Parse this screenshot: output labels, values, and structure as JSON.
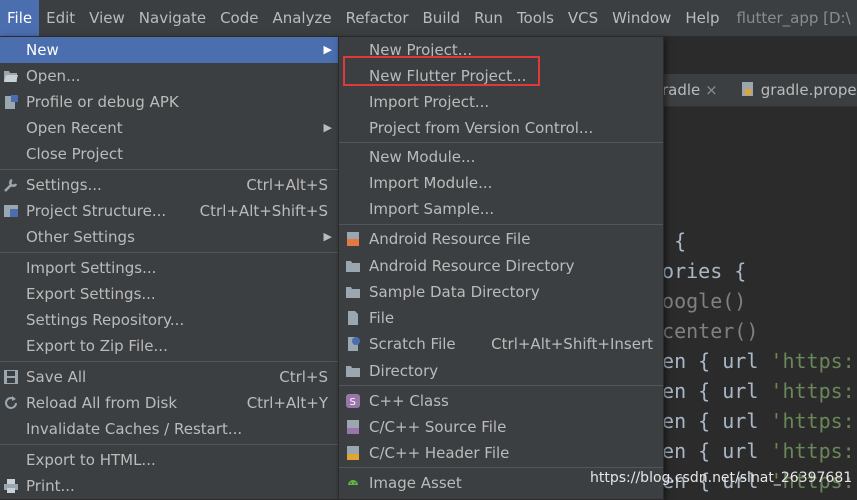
{
  "menubar": {
    "items": [
      "File",
      "Edit",
      "View",
      "Navigate",
      "Code",
      "Analyze",
      "Refactor",
      "Build",
      "Run",
      "Tools",
      "VCS",
      "Window",
      "Help"
    ],
    "title": "flutter_app [D:\\"
  },
  "editor": {
    "tab1": "radle",
    "tab1_close": "×",
    "tab2": "gradle.prope",
    "code": [
      {
        "a": "s {",
        "b": ""
      },
      {
        "a": "tories {",
        "b": ""
      },
      {
        "a": "google()",
        "b": ""
      },
      {
        "a": "jcenter()",
        "b": ""
      },
      {
        "a": "ven { url ",
        "b": "'https:"
      },
      {
        "a": "ven { url ",
        "b": "'https:"
      },
      {
        "a": "ven { url ",
        "b": "'https:"
      },
      {
        "a": "ven { url ",
        "b": "'https:"
      },
      {
        "a": "ven { url ",
        "b": "'https:"
      }
    ]
  },
  "file_menu": {
    "new": "New",
    "open": "Open...",
    "profile_apk": "Profile or debug APK",
    "open_recent": "Open Recent",
    "close_project": "Close Project",
    "settings": "Settings...",
    "settings_sc": "Ctrl+Alt+S",
    "project_structure": "Project Structure...",
    "project_structure_sc": "Ctrl+Alt+Shift+S",
    "other_settings": "Other Settings",
    "import_settings": "Import Settings...",
    "export_settings": "Export Settings...",
    "settings_repository": "Settings Repository...",
    "export_zip": "Export to Zip File...",
    "save_all": "Save All",
    "save_all_sc": "Ctrl+S",
    "reload": "Reload All from Disk",
    "reload_sc": "Ctrl+Alt+Y",
    "invalidate": "Invalidate Caches / Restart...",
    "export_html": "Export to HTML...",
    "print": "Print..."
  },
  "new_menu": {
    "new_project": "New Project...",
    "new_flutter_project": "New Flutter Project...",
    "import_project": "Import Project...",
    "project_vcs": "Project from Version Control...",
    "new_module": "New Module...",
    "import_module": "Import Module...",
    "import_sample": "Import Sample...",
    "android_resource_file": "Android Resource File",
    "android_resource_directory": "Android Resource Directory",
    "sample_data_directory": "Sample Data Directory",
    "file": "File",
    "scratch_file": "Scratch File",
    "scratch_file_sc": "Ctrl+Alt+Shift+Insert",
    "directory": "Directory",
    "cpp_class": "C++ Class",
    "cpp_source": "C/C++ Source File",
    "cpp_header": "C/C++ Header File",
    "image_asset": "Image Asset"
  },
  "watermark": "https://blog.csdn.net/sinat_26397681",
  "colors": {
    "highlight": "#4b6eaf",
    "menu_bg": "#3c3f41",
    "annotation": "#e0393a"
  }
}
